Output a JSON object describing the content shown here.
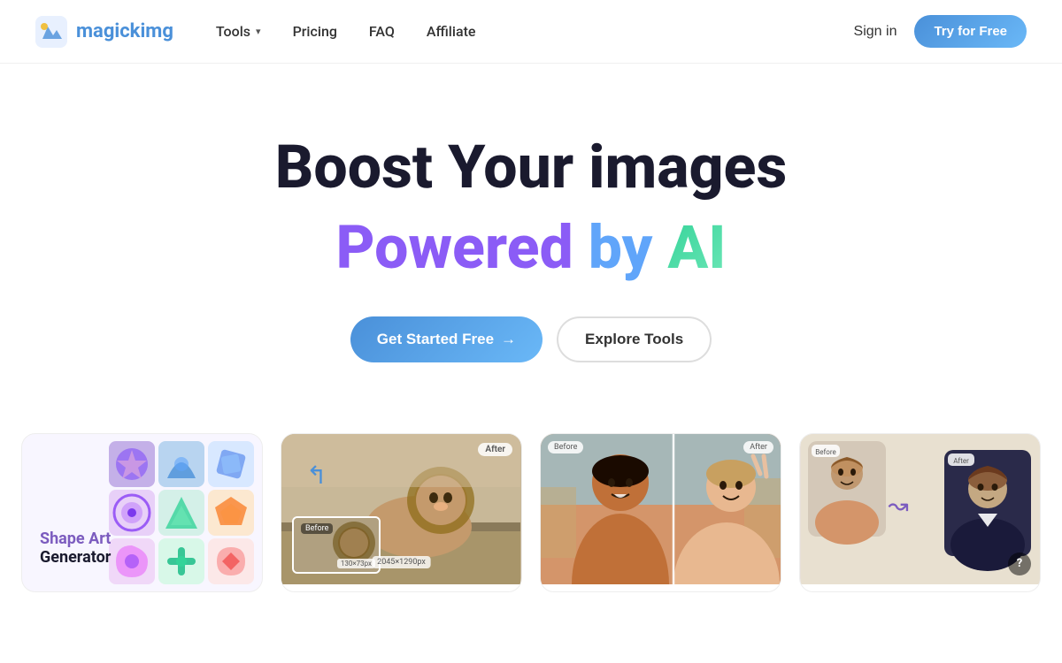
{
  "navbar": {
    "logo_text_main": "magick",
    "logo_text_accent": "img",
    "tools_label": "Tools",
    "pricing_label": "Pricing",
    "faq_label": "FAQ",
    "affiliate_label": "Affiliate",
    "signin_label": "Sign in",
    "try_free_label": "Try for Free"
  },
  "hero": {
    "title_line1": "Boost Your images",
    "title_line2_powered": "Powered",
    "title_line2_by": "by",
    "title_line2_ai": "AI",
    "cta_primary": "Get Started Free",
    "cta_primary_arrow": "→",
    "cta_secondary": "Explore Tools"
  },
  "cards": [
    {
      "id": "shape-art",
      "title_colored": "Shape Art",
      "title_plain": "Generator",
      "type": "shape-art"
    },
    {
      "id": "image-upscaler",
      "before_label": "Before",
      "after_label": "After",
      "size_label": "2045×1290px",
      "before_size": "130×73px",
      "type": "lion"
    },
    {
      "id": "photo-restoration",
      "before_label": "Before",
      "after_label": "After",
      "type": "friends"
    },
    {
      "id": "headshot",
      "before_label": "Before",
      "after_label": "After",
      "help": "?",
      "type": "headshot"
    }
  ],
  "colors": {
    "primary_blue": "#4a90d9",
    "accent_purple": "#8b5cf6",
    "accent_green": "#34d399",
    "nav_text": "#333333",
    "hero_title": "#1a1a2e"
  }
}
